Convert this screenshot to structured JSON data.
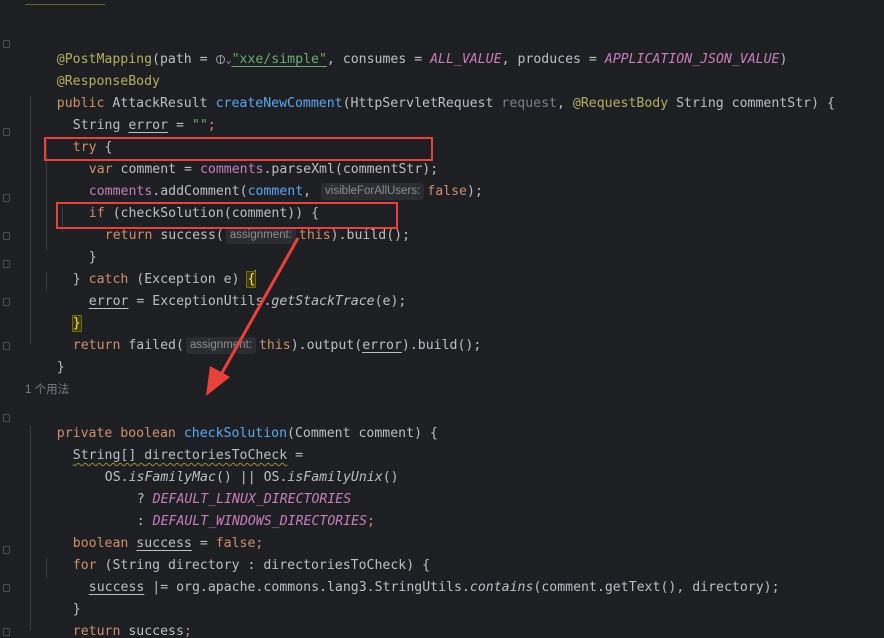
{
  "usage_hint": "1 个用法",
  "inlay_hints": {
    "visible_for_all_users": "visibleForAllUsers:",
    "assignment_1": "assignment:",
    "assignment_2": "assignment:"
  },
  "code": {
    "l1": {
      "ann1": "@PostMapping",
      "p1": "(path = ",
      "s1": "\"xxe/simple\"",
      "p2": ", consumes = ",
      "f1": "ALL_VALUE",
      "p3": ", produces = ",
      "f2": "APPLICATION_JSON_VALUE",
      "p4": ")"
    },
    "l2": {
      "ann": "@ResponseBody"
    },
    "l3": {
      "k1": "public ",
      "p1": "AttackResult ",
      "fn": "createNewComment",
      "p2": "(HttpServletRequest ",
      "g1": "request",
      "p3": ", ",
      "ann": "@RequestBody",
      "p4": " String commentStr) {"
    },
    "l4": {
      "p1": "String ",
      "u1": "error",
      "p2": " = ",
      "s1": "\"\"",
      "p3": ";"
    },
    "l5": {
      "k1": "try",
      "p1": " {"
    },
    "l6": {
      "k1": "var",
      "p1": " comment = ",
      "f1": "comments",
      "p2": ".parseXml(commentStr);"
    },
    "l7": {
      "f1": "comments",
      "p1": ".addComment(",
      "v1": "comment",
      "p2": ", ",
      "k1": "false",
      "p3": ");"
    },
    "l8": {
      "k1": "if",
      "p1": " (checkSolution(comment)) {"
    },
    "l9": {
      "k1": "return",
      "p1": " success(",
      "k2": "this",
      "p2": ").build();"
    },
    "l10": {
      "p1": "}"
    },
    "l11": {
      "p1": "} ",
      "k1": "catch",
      "p2": " (Exception e) ",
      "b1": "{"
    },
    "l12": {
      "u1": "error",
      "p1": " = ExceptionUtils.",
      "i1": "getStackTrace",
      "p2": "(e);"
    },
    "l13": {
      "p1": "}"
    },
    "l14": {
      "k1": "return",
      "p1": " failed(",
      "k2": "this",
      "p2": ").output(",
      "u1": "error",
      "p3": ").build();"
    },
    "l15": {
      "p1": "}"
    },
    "l16": {
      "k1": "private boolean ",
      "fn": "checkSolution",
      "p1": "(Comment comment) {"
    },
    "l17": {
      "w1": "String[] ",
      "u1": "directoriesToCheck",
      "p1": " ="
    },
    "l18": {
      "p1": "OS.",
      "i1": "isFamilyMac",
      "p2": "() || OS.",
      "i2": "isFamilyUnix",
      "p3": "()"
    },
    "l19": {
      "p1": "? ",
      "f1": "DEFAULT_LINUX_DIRECTORIES"
    },
    "l20": {
      "p1": ": ",
      "f1": "DEFAULT_WINDOWS_DIRECTORIES",
      "p2": ";"
    },
    "l21": {
      "k1": "boolean ",
      "u1": "success",
      "p1": " = ",
      "k2": "false",
      "p2": ";"
    },
    "l22": {
      "k1": "for",
      "p1": " (String directory : directoriesToCheck) {"
    },
    "l23": {
      "u1": "success",
      "p1": " |= org.apache.commons.lang3.StringUtils.",
      "i1": "contains",
      "p2": "(comment.getText(), directory);"
    },
    "l24": {
      "p1": "}"
    },
    "l25": {
      "k1": "return ",
      "u1": "success",
      "p1": ";"
    },
    "l26": {
      "p1": "}"
    }
  },
  "colors": {
    "background": "#1e1f22",
    "keyword": "#cf8e6d",
    "annotation": "#b3ae60",
    "method": "#56a8f5",
    "field": "#c77dbb",
    "string": "#6aab73",
    "highlight_box": "#e8403b",
    "arrow": "#e8403b"
  }
}
